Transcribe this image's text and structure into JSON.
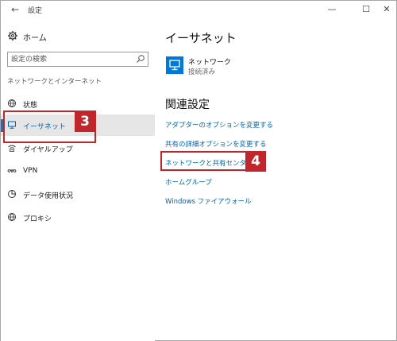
{
  "titlebar": {
    "title": "設定",
    "back_icon": "back-arrow-icon",
    "minimize_icon": "minimize-icon",
    "maximize_icon": "maximize-icon",
    "close_icon": "close-icon"
  },
  "sidebar": {
    "home_label": "ホーム",
    "search_placeholder": "設定の検索",
    "section_label": "ネットワークとインターネット",
    "items": [
      {
        "label": "状態",
        "icon": "globe-status-icon"
      },
      {
        "label": "イーサネット",
        "icon": "monitor-icon",
        "active": true
      },
      {
        "label": "ダイヤルアップ",
        "icon": "dialup-icon"
      },
      {
        "label": "VPN",
        "icon": "vpn-icon"
      },
      {
        "label": "データ使用状況",
        "icon": "data-usage-icon"
      },
      {
        "label": "プロキシ",
        "icon": "globe-icon"
      }
    ]
  },
  "main": {
    "title": "イーサネット",
    "network": {
      "name": "ネットワーク",
      "status": "接続済み"
    },
    "related_title": "関連設定",
    "links": [
      "アダプターのオプションを変更する",
      "共有の詳細オプションを変更する",
      "ネットワークと共有センター",
      "ホームグループ",
      "Windows ファイアウォール"
    ]
  },
  "annotations": {
    "badge_3": "3",
    "badge_4": "4",
    "color": "#c0272d"
  },
  "colors": {
    "accent": "#0078d7",
    "link": "#0063b1",
    "annotation": "#c0272d"
  }
}
